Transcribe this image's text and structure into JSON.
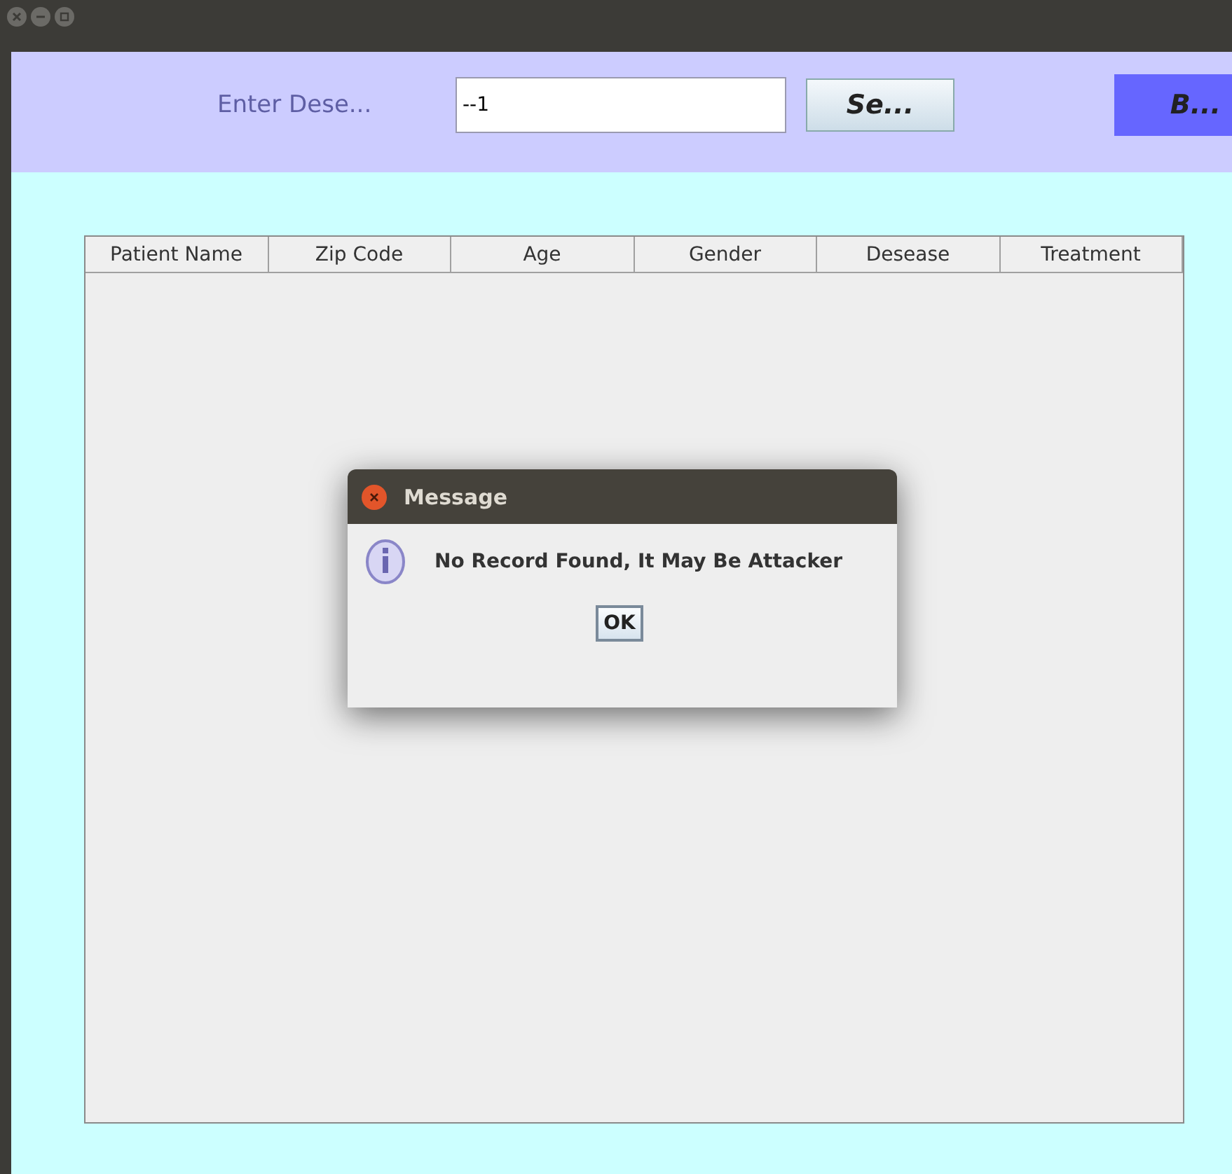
{
  "search_bar": {
    "label": "Enter Dese...",
    "value": "--1",
    "search_button": "Se...",
    "back_button": "B..."
  },
  "table": {
    "columns": [
      "Patient Name",
      "Zip Code",
      "Age",
      "Gender",
      "Desease",
      "Treatment"
    ]
  },
  "dialog": {
    "title": "Message",
    "message": "No Record Found, It May Be Attacker",
    "button": "OK"
  }
}
